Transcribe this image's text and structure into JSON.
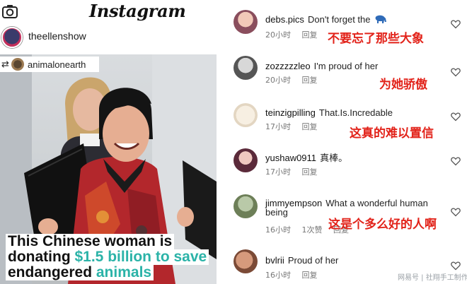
{
  "header": {
    "app_title": "Instagram",
    "camera_icon": "camera-icon"
  },
  "post": {
    "author": "theellenshow",
    "repost_handle": "animalonearth",
    "repost_icon": "repost-icon",
    "caption": {
      "line1": "This Chinese woman is",
      "line2_prefix": "donating ",
      "line2_amount": "$1.5 billion to save",
      "line3_prefix": "endangered ",
      "line3_highlight": "animals"
    }
  },
  "comments": [
    {
      "user": "debs.pics",
      "text": "Don't forget the",
      "emoji": "elephant-icon",
      "time": "20小时",
      "reply": "回复",
      "likes": "",
      "translation": "不要忘了那些大象"
    },
    {
      "user": "zozzzzzleo",
      "text": "I'm proud of her",
      "time": "20小时",
      "reply": "回复",
      "likes": "",
      "translation": "为她骄傲"
    },
    {
      "user": "teinzigpilling",
      "text": "That.Is.Incredable",
      "time": "17小时",
      "reply": "回复",
      "likes": "",
      "translation": "这真的难以置信"
    },
    {
      "user": "yushaw0911",
      "text": "真棒。",
      "time": "17小时",
      "reply": "回复",
      "likes": "",
      "translation": ""
    },
    {
      "user": "jimmyempson",
      "text": "What a wonderful human",
      "text2": "being",
      "time": "16小时",
      "reply": "回复",
      "likes": "1次赞",
      "translation": "这是个多么好的人啊"
    },
    {
      "user": "bvlrii",
      "text": "Proud of her",
      "time": "16小时",
      "reply": "回复",
      "likes": "",
      "translation": ""
    }
  ],
  "watermark": "网易号 | 社翔手工制作",
  "colors": {
    "translation_red": "#e2231a",
    "caption_teal": "#2bb3a8"
  }
}
